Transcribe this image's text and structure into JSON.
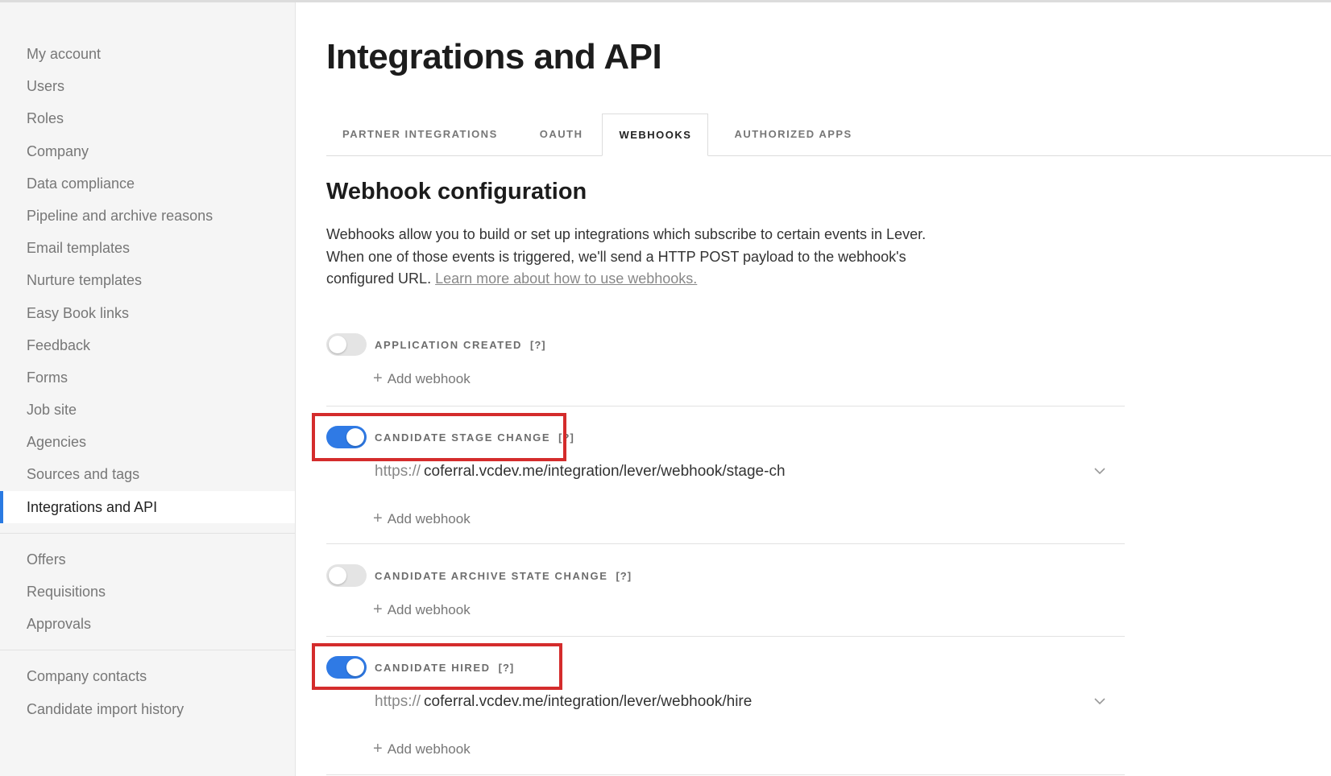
{
  "sidebar": {
    "group1": [
      {
        "label": "My account"
      },
      {
        "label": "Users"
      },
      {
        "label": "Roles"
      },
      {
        "label": "Company"
      },
      {
        "label": "Data compliance"
      },
      {
        "label": "Pipeline and archive reasons"
      },
      {
        "label": "Email templates"
      },
      {
        "label": "Nurture templates"
      },
      {
        "label": "Easy Book links"
      },
      {
        "label": "Feedback"
      },
      {
        "label": "Forms"
      },
      {
        "label": "Job site"
      },
      {
        "label": "Agencies"
      },
      {
        "label": "Sources and tags"
      },
      {
        "label": "Integrations and API",
        "active": true
      }
    ],
    "group2": [
      {
        "label": "Offers"
      },
      {
        "label": "Requisitions"
      },
      {
        "label": "Approvals"
      }
    ],
    "group3": [
      {
        "label": "Company contacts"
      },
      {
        "label": "Candidate import history"
      }
    ]
  },
  "main": {
    "title": "Integrations and API",
    "tabs": [
      {
        "label": "PARTNER INTEGRATIONS"
      },
      {
        "label": "OAUTH"
      },
      {
        "label": "WEBHOOKS",
        "active": true
      },
      {
        "label": "AUTHORIZED APPS"
      }
    ],
    "section_title": "Webhook configuration",
    "intro": "Webhooks allow you to build or set up integrations which subscribe to certain events in Lever. When one of those events is triggered, we'll send a HTTP POST payload to the webhook's configured URL.",
    "intro_link": "Learn more about how to use webhooks.",
    "webhooks": [
      {
        "label": "APPLICATION CREATED",
        "help": "[?]",
        "enabled": false,
        "add_label": "Add webhook"
      },
      {
        "label": "CANDIDATE STAGE CHANGE",
        "help": "[?]",
        "enabled": true,
        "url_scheme": "https://",
        "url": "coferral.vcdev.me/integration/lever/webhook/stage-ch",
        "add_label": "Add webhook"
      },
      {
        "label": "CANDIDATE ARCHIVE STATE CHANGE",
        "help": "[?]",
        "enabled": false,
        "add_label": "Add webhook"
      },
      {
        "label": "CANDIDATE HIRED",
        "help": "[?]",
        "enabled": true,
        "url_scheme": "https://",
        "url": "coferral.vcdev.me/integration/lever/webhook/hire",
        "add_label": "Add webhook"
      }
    ]
  },
  "colors": {
    "accent": "#2f7ae5",
    "highlight": "#d42c2c",
    "sidebar_bg": "#f5f5f5"
  },
  "icons": {
    "plus": "plus-icon",
    "chevron": "chevron-down-icon"
  }
}
